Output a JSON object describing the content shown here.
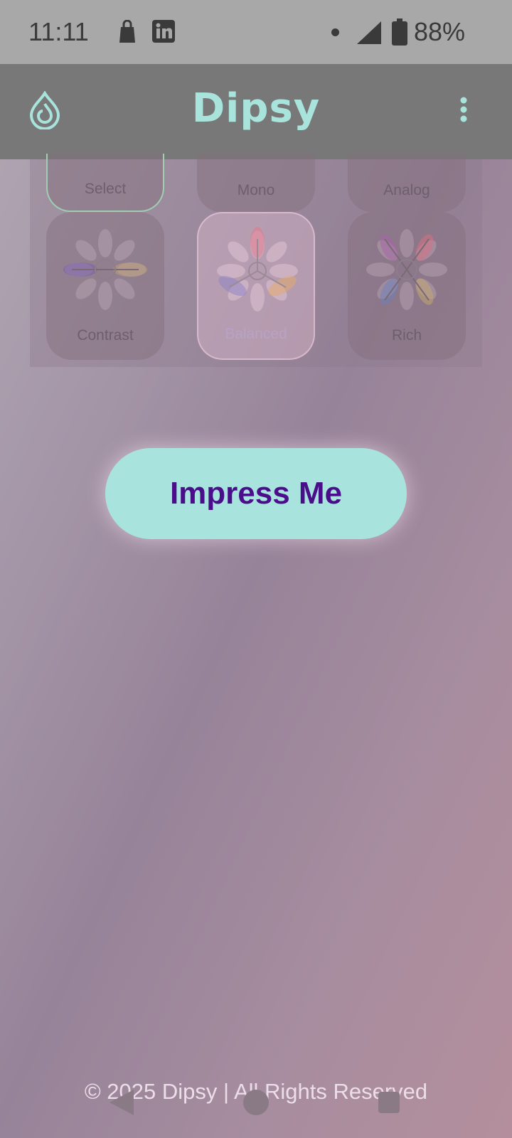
{
  "status_bar": {
    "time": "11:11",
    "battery": "88%",
    "icons": [
      "shopping-bag-icon",
      "linkedin-icon",
      "notification-dot-icon",
      "cell-signal-icon",
      "battery-icon"
    ]
  },
  "app_bar": {
    "title": "Dipsy",
    "logo_icon": "water-drop-icon",
    "menu_icon": "more-vert-icon",
    "accent_color": "#a8e4dc"
  },
  "schemes": {
    "top_row": [
      {
        "label": "Select",
        "selected": true
      },
      {
        "label": "Mono"
      },
      {
        "label": "Analog"
      }
    ],
    "bottom_row": [
      {
        "label": "Contrast"
      },
      {
        "label": "Balanced",
        "active": true
      },
      {
        "label": "Rich"
      }
    ]
  },
  "main": {
    "impress_button": "Impress Me",
    "button_color": "#a8e4dd",
    "button_text_color": "#4a0e8a"
  },
  "footer": {
    "text": "© 2025 Dipsy | All Rights Reserved"
  },
  "nav_bar": {
    "icons": [
      "back-icon",
      "home-icon",
      "recents-icon"
    ]
  }
}
